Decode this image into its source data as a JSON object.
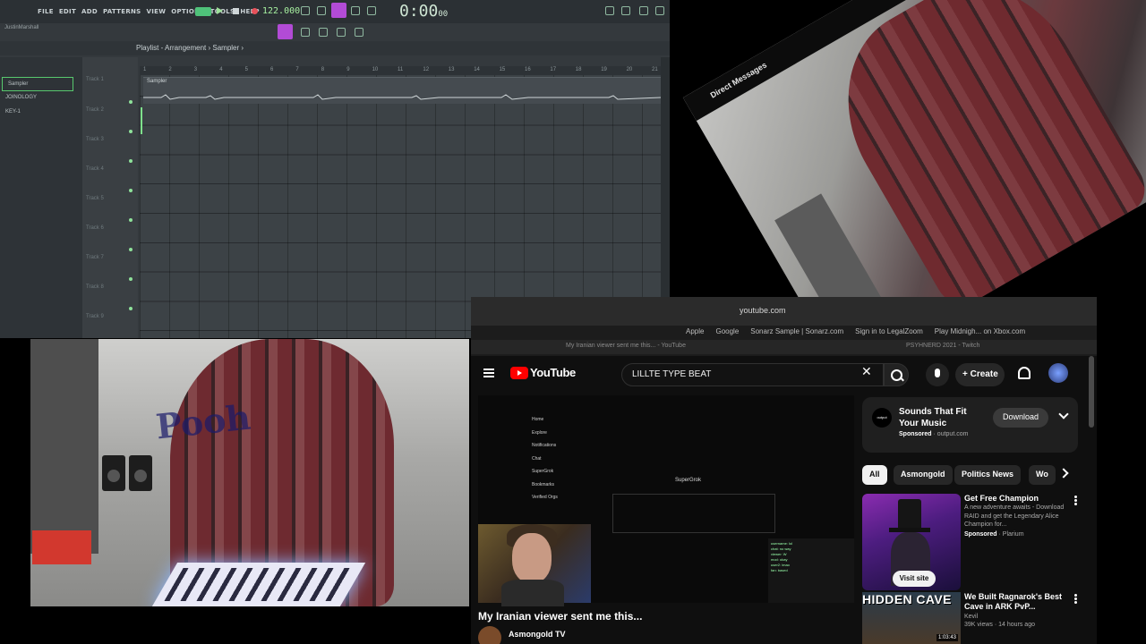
{
  "fl": {
    "menu": [
      "FILE",
      "EDIT",
      "ADD",
      "PATTERNS",
      "VIEW",
      "OPTIONS",
      "TOOLS",
      "HELP"
    ],
    "tempo": "122.000",
    "clock": "0:00",
    "clock_small": "00",
    "user": "JustinMarshall",
    "breadcrumb": "Playlist - Arrangement › Sampler ›",
    "browser_items": [
      "Sampler",
      "JOINOLOGY",
      "KEY-1"
    ],
    "track_header": "Track 1",
    "tracks": [
      "Track 2",
      "Track 3",
      "Track 4",
      "Track 5",
      "Track 6",
      "Track 7",
      "Track 8",
      "Track 9"
    ],
    "ruler": [
      "1",
      "2",
      "3",
      "4",
      "5",
      "6",
      "7",
      "8",
      "9",
      "10",
      "11",
      "12",
      "13",
      "14",
      "15",
      "16",
      "17",
      "18",
      "19",
      "20",
      "21"
    ],
    "clip_label": "Sampler"
  },
  "dm": {
    "label": "Direct Messages"
  },
  "cam2": {
    "logo": "Pooh"
  },
  "safari": {
    "url": "youtube.com",
    "favorites": [
      "Apple",
      "Google",
      "Sonarz Sample | Sonarz.com",
      "Sign in to LegalZoom",
      "Play Midnigh... on Xbox.com"
    ],
    "tabs": [
      "My Iranian viewer sent me this... - YouTube",
      "PSYHNERD 2021 - Twitch"
    ]
  },
  "yt": {
    "logo": "YouTube",
    "search_value": "LILLTE TYPE BEAT",
    "create": "Create",
    "video_title": "My Iranian viewer sent me this...",
    "channel": "Asmongold TV",
    "player": {
      "nav": [
        "Home",
        "Explore",
        "Notifications",
        "Chat",
        "SuperGrok",
        "Bookmarks",
        "Verified Orgs"
      ],
      "superbrain": "SuperGrok",
      "chat_lines": [
        "username: lol",
        "chat: no way",
        "viewer: W",
        "mod: okay",
        "user2: lmao",
        "fan: based"
      ]
    },
    "ad": {
      "logo_text": "output",
      "title": "Sounds That Fit Your Music",
      "sponsored": "Sponsored",
      "domain": "output.com",
      "download": "Download"
    },
    "chips": [
      "All",
      "Asmongold",
      "Politics News",
      "Wo"
    ],
    "items": [
      {
        "title": "Get Free Champion",
        "desc": "A new adventure awaits - Download RAID and get the Legendary Alice Champion for...",
        "sponsored": "Sponsored",
        "sponsor": "Plarium",
        "cta": "Visit site"
      },
      {
        "caption": "HIDDEN CAVE",
        "duration": "1:03:43",
        "title": "We Built Ragnarok's Best Cave in ARK PvP...",
        "channel": "Kevil",
        "views": "39K views · 14 hours ago"
      }
    ]
  },
  "colors": {
    "fl_accent": "#58c96e",
    "fl_mode": "#b24bd6",
    "yt_red": "#ff0000",
    "yt_bg": "#0f0f0f"
  }
}
